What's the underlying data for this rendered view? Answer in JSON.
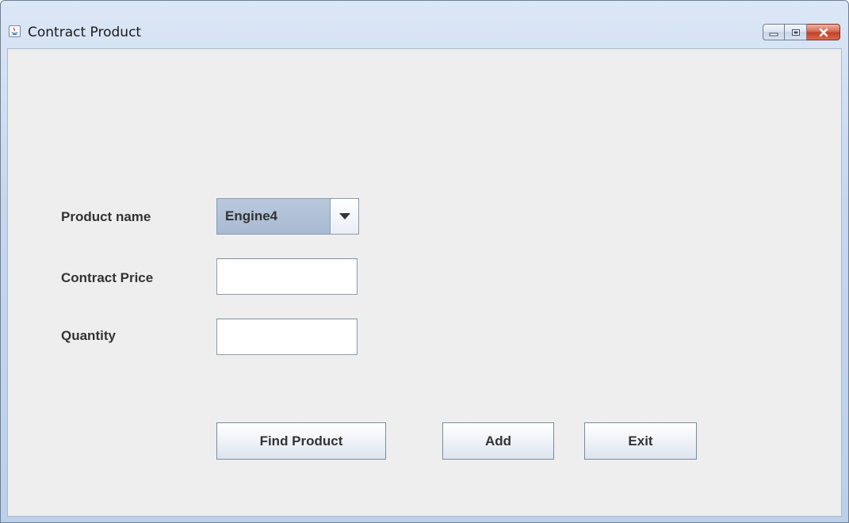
{
  "window": {
    "title": "Contract Product",
    "controls": [
      "minimize-icon",
      "maximize-icon",
      "close-icon"
    ]
  },
  "form": {
    "product_name_label": "Product name",
    "product_name_selected": "Engine4",
    "contract_price_label": "Contract Price",
    "contract_price_value": "",
    "quantity_label": "Quantity",
    "quantity_value": ""
  },
  "buttons": {
    "find_product": "Find Product",
    "add": "Add",
    "exit": "Exit"
  },
  "colors": {
    "close_button": "#c2402a",
    "combo_background": "#b0c0d7",
    "client_background": "#eeeeee"
  }
}
